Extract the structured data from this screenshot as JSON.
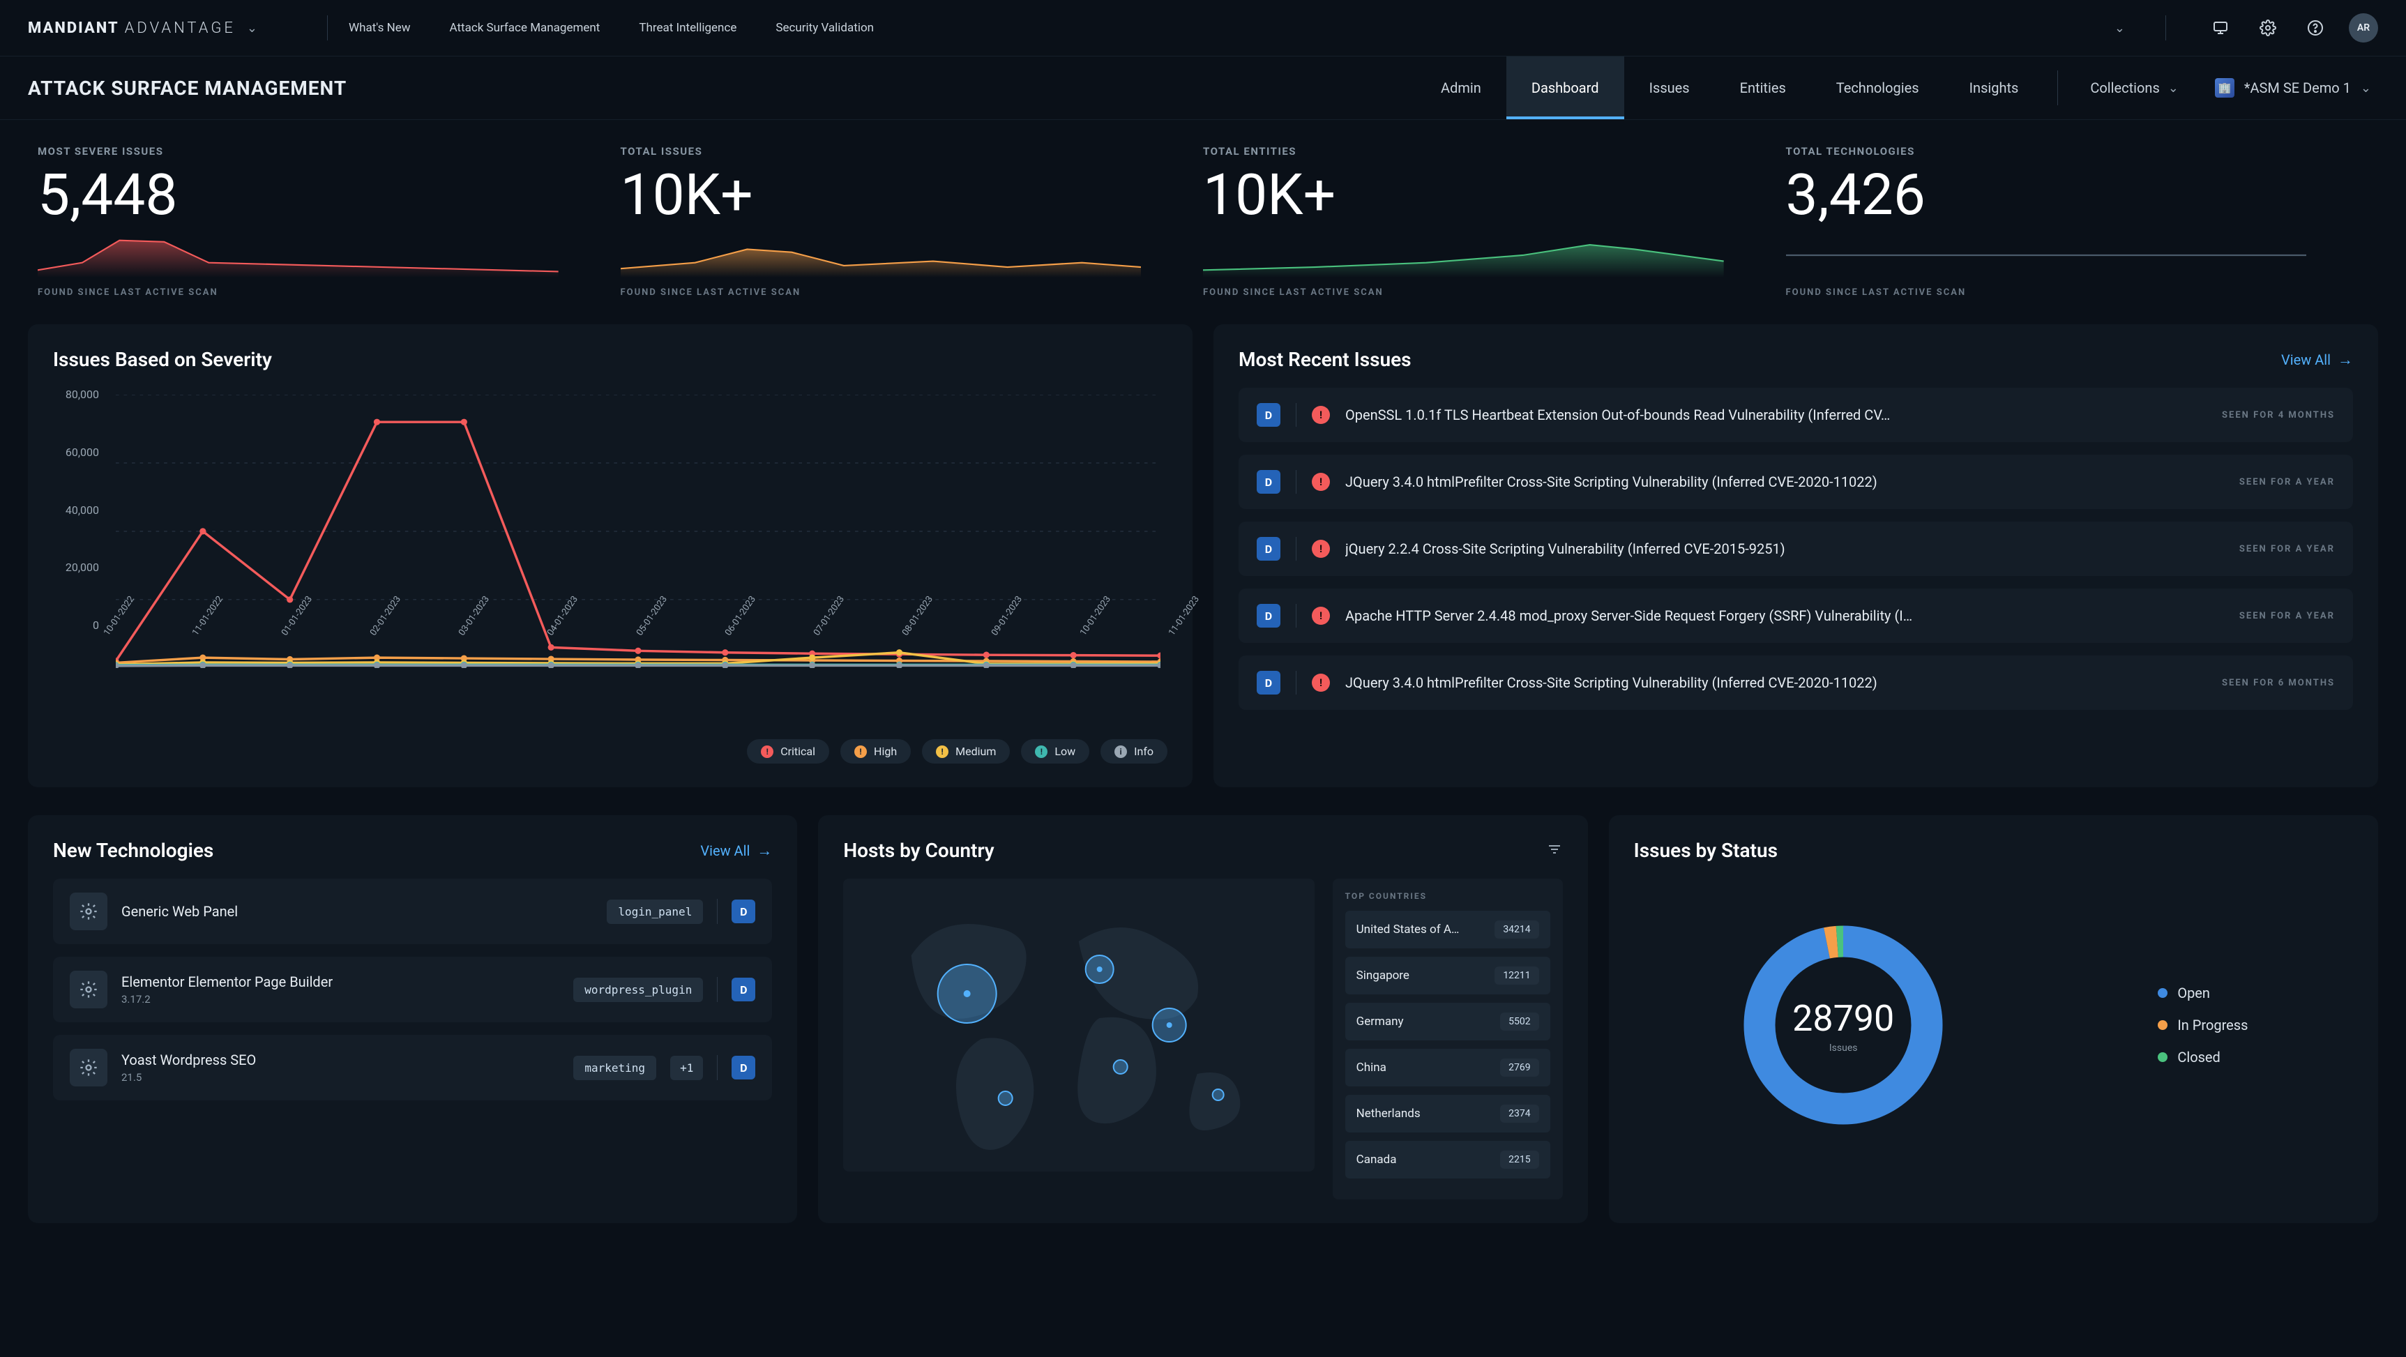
{
  "brand": {
    "main": "MANDIANT",
    "sub": "ADVANTAGE"
  },
  "top_nav": {
    "whats_new": "What's New",
    "asm": "Attack Surface Management",
    "ti": "Threat Intelligence",
    "sv": "Security Validation"
  },
  "avatar_initials": "AR",
  "section_title": "ATTACK SURFACE MANAGEMENT",
  "sub_nav": {
    "admin": "Admin",
    "dashboard": "Dashboard",
    "issues": "Issues",
    "entities": "Entities",
    "technologies": "Technologies",
    "insights": "Insights",
    "collections": "Collections",
    "project": "*ASM SE Demo 1"
  },
  "kpi": {
    "severe_label": "MOST SEVERE ISSUES",
    "severe_value": "5,448",
    "issues_label": "TOTAL ISSUES",
    "issues_value": "10K+",
    "entities_label": "TOTAL ENTITIES",
    "entities_value": "10K+",
    "tech_label": "TOTAL TECHNOLOGIES",
    "tech_value": "3,426",
    "footer": "FOUND SINCE LAST ACTIVE SCAN"
  },
  "severity_panel": {
    "title": "Issues Based on Severity",
    "y_ticks": [
      "80,000",
      "60,000",
      "40,000",
      "20,000",
      "0"
    ],
    "legend": {
      "critical": "Critical",
      "high": "High",
      "medium": "Medium",
      "low": "Low",
      "info": "Info"
    }
  },
  "recent_panel": {
    "title": "Most Recent Issues",
    "view_all": "View All",
    "rows": [
      {
        "title": "OpenSSL 1.0.1f TLS Heartbeat Extension Out-of-bounds Read Vulnerability (Inferred CV…",
        "seen": "SEEN FOR 4 MONTHS"
      },
      {
        "title": "JQuery 3.4.0 htmlPrefilter Cross-Site Scripting Vulnerability (Inferred CVE-2020-11022)",
        "seen": "SEEN FOR A YEAR"
      },
      {
        "title": "jQuery 2.2.4 Cross-Site Scripting Vulnerability (Inferred CVE-2015-9251)",
        "seen": "SEEN FOR A YEAR"
      },
      {
        "title": "Apache HTTP Server 2.4.48 mod_proxy Server-Side Request Forgery (SSRF) Vulnerability (I…",
        "seen": "SEEN FOR A YEAR"
      },
      {
        "title": "JQuery 3.4.0 htmlPrefilter Cross-Site Scripting Vulnerability (Inferred CVE-2020-11022)",
        "seen": "SEEN FOR 6 MONTHS"
      }
    ]
  },
  "new_tech_panel": {
    "title": "New Technologies",
    "view_all": "View All",
    "rows": [
      {
        "name": "Generic Web Panel",
        "version": "",
        "tag": "login_panel",
        "extra": "",
        "d": "D"
      },
      {
        "name": "Elementor Elementor Page Builder",
        "version": "3.17.2",
        "tag": "wordpress_plugin",
        "extra": "",
        "d": "D"
      },
      {
        "name": "Yoast Wordpress SEO",
        "version": "21.5",
        "tag": "marketing",
        "extra": "+1",
        "d": "D"
      }
    ]
  },
  "hosts_panel": {
    "title": "Hosts by Country",
    "top_label": "TOP COUNTRIES",
    "countries": [
      {
        "name": "United States of A…",
        "count": "34214"
      },
      {
        "name": "Singapore",
        "count": "12211"
      },
      {
        "name": "Germany",
        "count": "5502"
      },
      {
        "name": "China",
        "count": "2769"
      },
      {
        "name": "Netherlands",
        "count": "2374"
      },
      {
        "name": "Canada",
        "count": "2215"
      }
    ]
  },
  "status_panel": {
    "title": "Issues by Status",
    "total": "28790",
    "sub": "Issues",
    "legend": {
      "open": "Open",
      "in_progress": "In Progress",
      "closed": "Closed"
    }
  },
  "chart_data": [
    {
      "id": "issues_based_on_severity",
      "type": "line",
      "xlabel": "",
      "ylabel": "",
      "ylim": [
        0,
        80000
      ],
      "categories": [
        "10-01-2022",
        "11-01-2022",
        "01-01-2023",
        "02-01-2023",
        "03-01-2023",
        "04-01-2023",
        "05-01-2023",
        "06-01-2023",
        "07-01-2023",
        "08-01-2023",
        "09-01-2023",
        "10-01-2023",
        "11-01-2023"
      ],
      "series": [
        {
          "name": "Critical",
          "color": "#f45b5b",
          "values": [
            2000,
            40000,
            20000,
            72000,
            72000,
            6000,
            5000,
            4500,
            4200,
            4000,
            3800,
            3700,
            3600
          ]
        },
        {
          "name": "High",
          "color": "#f59f49",
          "values": [
            1500,
            3000,
            2500,
            3000,
            2800,
            2600,
            2400,
            2300,
            2200,
            2100,
            2000,
            1900,
            1800
          ]
        },
        {
          "name": "Medium",
          "color": "#f3c046",
          "values": [
            1000,
            1600,
            1500,
            1600,
            1500,
            1400,
            1300,
            1300,
            3000,
            4500,
            1200,
            1200,
            1200
          ]
        },
        {
          "name": "Low",
          "color": "#3fb8af",
          "values": [
            800,
            900,
            900,
            900,
            900,
            900,
            900,
            900,
            900,
            900,
            900,
            900,
            900
          ]
        },
        {
          "name": "Info",
          "color": "#8896a3",
          "values": [
            600,
            700,
            700,
            700,
            700,
            700,
            700,
            700,
            700,
            700,
            700,
            700,
            700
          ]
        }
      ]
    },
    {
      "id": "kpi_spark_severe",
      "type": "area",
      "series": [
        {
          "name": "severe",
          "color": "#f45b5b",
          "values": [
            4,
            6,
            12,
            28,
            26,
            12,
            10,
            9,
            9,
            8,
            8,
            8,
            8,
            8
          ]
        }
      ]
    },
    {
      "id": "kpi_spark_issues",
      "type": "area",
      "series": [
        {
          "name": "issues",
          "color": "#f59f49",
          "values": [
            6,
            7,
            9,
            16,
            14,
            9,
            8,
            8,
            9,
            11,
            9,
            8,
            9,
            10
          ]
        }
      ]
    },
    {
      "id": "kpi_spark_entities",
      "type": "area",
      "series": [
        {
          "name": "entities",
          "color": "#4ac27e",
          "values": [
            6,
            7,
            8,
            8,
            9,
            10,
            11,
            12,
            13,
            15,
            18,
            17,
            14,
            12
          ]
        }
      ]
    },
    {
      "id": "kpi_spark_tech",
      "type": "line",
      "series": [
        {
          "name": "tech",
          "color": "#6a7784",
          "values": [
            10,
            10,
            10,
            10,
            10,
            10,
            10,
            10,
            10,
            10,
            10,
            10,
            10,
            10
          ]
        }
      ]
    },
    {
      "id": "issues_by_status_donut",
      "type": "pie",
      "total": 28790,
      "series": [
        {
          "name": "Open",
          "color": "#3f8ae0",
          "value_pct": 97
        },
        {
          "name": "In Progress",
          "color": "#f59f49",
          "value_pct": 2
        },
        {
          "name": "Closed",
          "color": "#4ac27e",
          "value_pct": 1
        }
      ]
    },
    {
      "id": "hosts_by_country_map_bubbles",
      "type": "scatter",
      "note": "bubble size ~ host count",
      "series": [
        {
          "name": "United States of America",
          "value": 34214
        },
        {
          "name": "Singapore",
          "value": 12211
        },
        {
          "name": "Germany",
          "value": 5502
        },
        {
          "name": "China",
          "value": 2769
        },
        {
          "name": "Netherlands",
          "value": 2374
        },
        {
          "name": "Canada",
          "value": 2215
        }
      ]
    }
  ]
}
